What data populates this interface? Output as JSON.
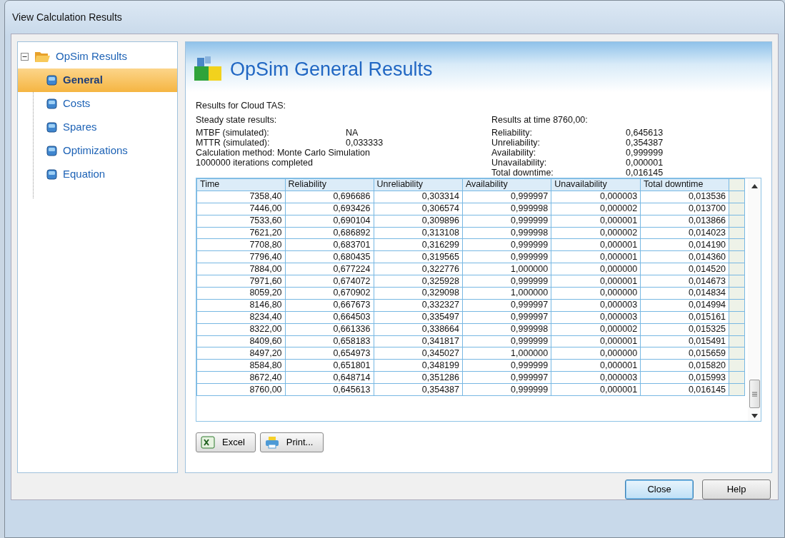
{
  "window": {
    "title": "View Calculation Results"
  },
  "tree": {
    "label": "OpSim Results",
    "expanded": true,
    "children": [
      {
        "label": "General",
        "selected": true
      },
      {
        "label": "Costs",
        "selected": false
      },
      {
        "label": "Spares",
        "selected": false
      },
      {
        "label": "Optimizations",
        "selected": false
      },
      {
        "label": "Equation",
        "selected": false
      }
    ]
  },
  "panel": {
    "title": "OpSim General Results"
  },
  "results_for": "Results for Cloud TAS:",
  "steady_state": {
    "heading": "Steady state results:",
    "rows": [
      {
        "label": "MTBF (simulated):",
        "value": "NA"
      },
      {
        "label": "MTTR (simulated):",
        "value": "0,033333"
      }
    ],
    "method": "Calculation method:  Monte Carlo Simulation",
    "iterations": "1000000 iterations completed"
  },
  "at_time": {
    "heading": "Results at time 8760,00:",
    "rows": [
      {
        "label": "Reliability:",
        "value": "0,645613"
      },
      {
        "label": "Unreliability:",
        "value": "0,354387"
      },
      {
        "label": "Availability:",
        "value": "0,999999"
      },
      {
        "label": "Unavailability:",
        "value": "0,000001"
      },
      {
        "label": "Total downtime:",
        "value": "0,016145"
      }
    ]
  },
  "table": {
    "columns": [
      "Time",
      "Reliability",
      "Unreliability",
      "Availability",
      "Unavailability",
      "Total downtime"
    ],
    "rows": [
      [
        "7358,40",
        "0,696686",
        "0,303314",
        "0,999997",
        "0,000003",
        "0,013536"
      ],
      [
        "7446,00",
        "0,693426",
        "0,306574",
        "0,999998",
        "0,000002",
        "0,013700"
      ],
      [
        "7533,60",
        "0,690104",
        "0,309896",
        "0,999999",
        "0,000001",
        "0,013866"
      ],
      [
        "7621,20",
        "0,686892",
        "0,313108",
        "0,999998",
        "0,000002",
        "0,014023"
      ],
      [
        "7708,80",
        "0,683701",
        "0,316299",
        "0,999999",
        "0,000001",
        "0,014190"
      ],
      [
        "7796,40",
        "0,680435",
        "0,319565",
        "0,999999",
        "0,000001",
        "0,014360"
      ],
      [
        "7884,00",
        "0,677224",
        "0,322776",
        "1,000000",
        "0,000000",
        "0,014520"
      ],
      [
        "7971,60",
        "0,674072",
        "0,325928",
        "0,999999",
        "0,000001",
        "0,014673"
      ],
      [
        "8059,20",
        "0,670902",
        "0,329098",
        "1,000000",
        "0,000000",
        "0,014834"
      ],
      [
        "8146,80",
        "0,667673",
        "0,332327",
        "0,999997",
        "0,000003",
        "0,014994"
      ],
      [
        "8234,40",
        "0,664503",
        "0,335497",
        "0,999997",
        "0,000003",
        "0,015161"
      ],
      [
        "8322,00",
        "0,661336",
        "0,338664",
        "0,999998",
        "0,000002",
        "0,015325"
      ],
      [
        "8409,60",
        "0,658183",
        "0,341817",
        "0,999999",
        "0,000001",
        "0,015491"
      ],
      [
        "8497,20",
        "0,654973",
        "0,345027",
        "1,000000",
        "0,000000",
        "0,015659"
      ],
      [
        "8584,80",
        "0,651801",
        "0,348199",
        "0,999999",
        "0,000001",
        "0,015820"
      ],
      [
        "8672,40",
        "0,648714",
        "0,351286",
        "0,999997",
        "0,000003",
        "0,015993"
      ],
      [
        "8760,00",
        "0,645613",
        "0,354387",
        "0,999999",
        "0,000001",
        "0,016145"
      ]
    ]
  },
  "export_buttons": [
    {
      "kind": "excel",
      "label": "Excel"
    },
    {
      "kind": "print",
      "label": "Print..."
    }
  ],
  "dialog_buttons": [
    {
      "label": "Close",
      "default": true
    },
    {
      "label": "Help",
      "default": false
    }
  ]
}
